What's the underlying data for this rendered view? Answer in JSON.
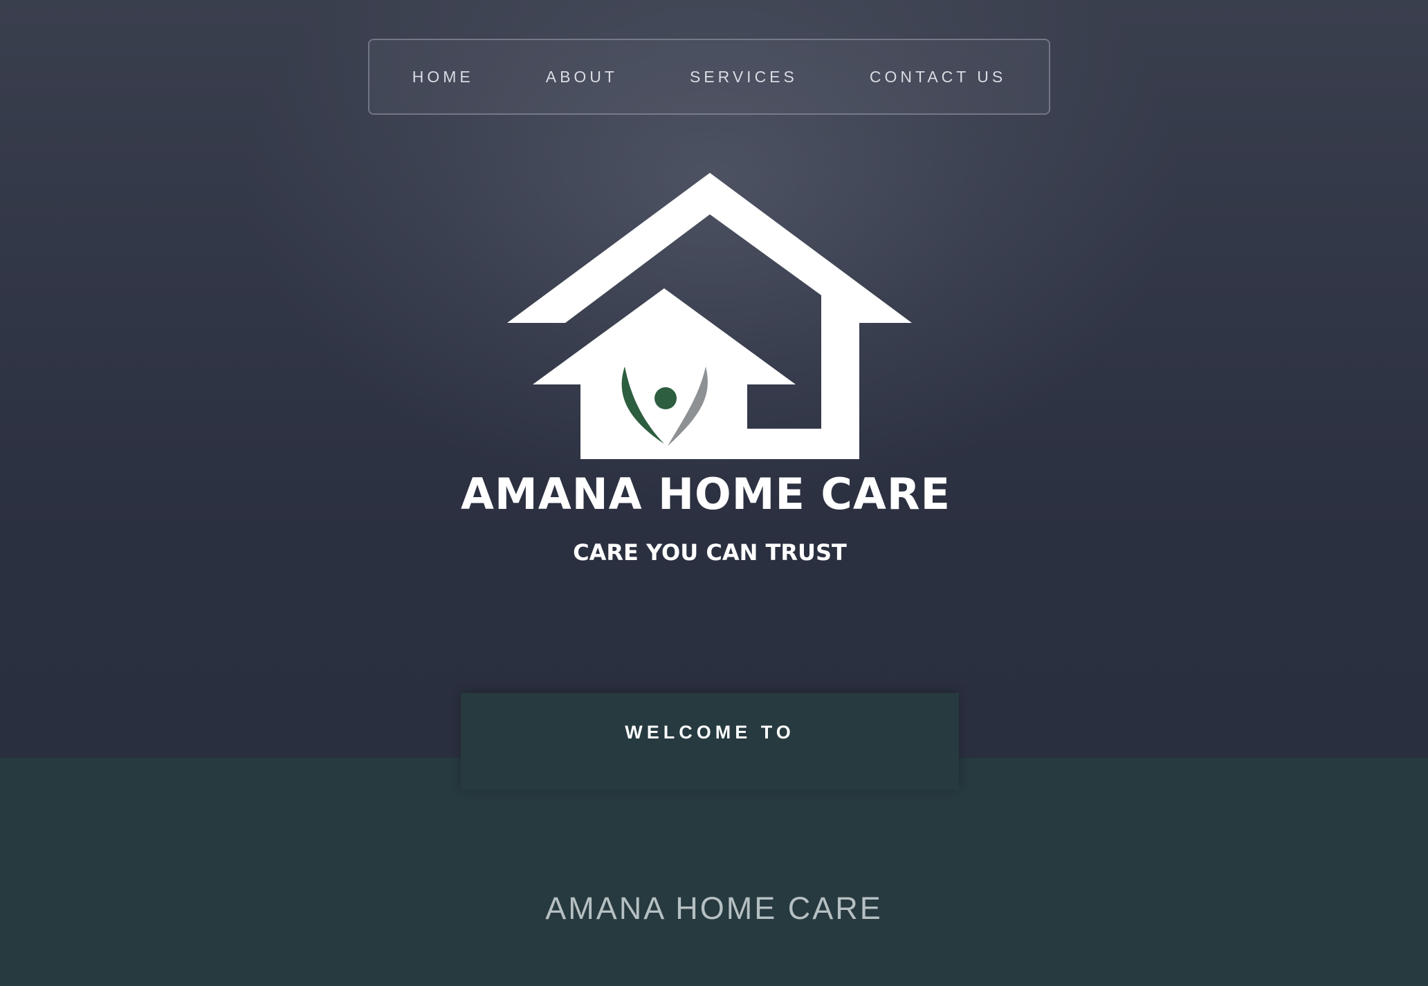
{
  "nav": {
    "items": [
      {
        "label": "HOME"
      },
      {
        "label": "ABOUT"
      },
      {
        "label": "SERVICES"
      },
      {
        "label": "CONTACT US"
      }
    ]
  },
  "logo": {
    "name": "AMANA HOME CARE",
    "tagline": "CARE YOU CAN TRUST",
    "icon": "house-with-person-icon",
    "colors": {
      "house": "#ffffff",
      "person_green": "#2c5e3f",
      "person_gray": "#8e9194"
    }
  },
  "welcome": {
    "label": "WELCOME TO"
  },
  "main": {
    "company_name": "AMANA HOME CARE"
  },
  "colors": {
    "hero_background": "#2e3343",
    "section_background": "#273a40",
    "nav_text": "#d9dce3",
    "heading_text": "#b6c0c2"
  }
}
